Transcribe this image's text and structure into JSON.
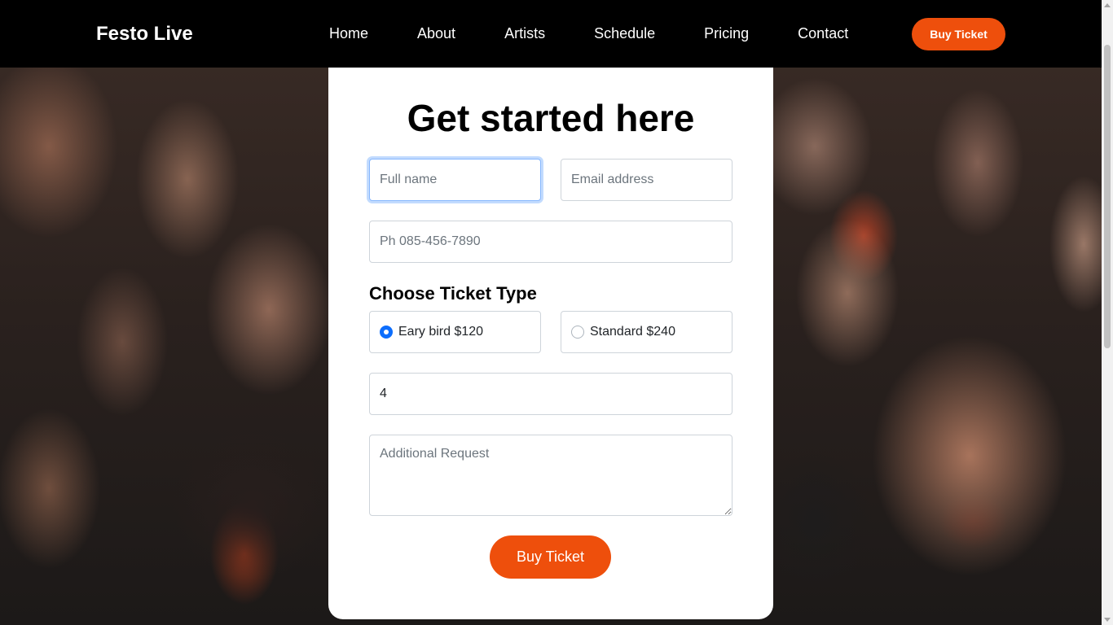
{
  "header": {
    "brand": "Festo Live",
    "nav": [
      "Home",
      "About",
      "Artists",
      "Schedule",
      "Pricing",
      "Contact"
    ],
    "cta_label": "Buy Ticket"
  },
  "form": {
    "title": "Get started here",
    "full_name_placeholder": "Full name",
    "email_placeholder": "Email address",
    "phone_placeholder": "Ph 085-456-7890",
    "ticket_section_title": "Choose Ticket Type",
    "ticket_options": [
      {
        "label": "Eary bird $120",
        "checked": true
      },
      {
        "label": "Standard $240",
        "checked": false
      }
    ],
    "quantity_value": "4",
    "request_placeholder": "Additional Request",
    "submit_label": "Buy Ticket"
  },
  "colors": {
    "accent": "#ee4f0c",
    "navbar": "#000000",
    "radio_checked": "#0d6efd"
  }
}
